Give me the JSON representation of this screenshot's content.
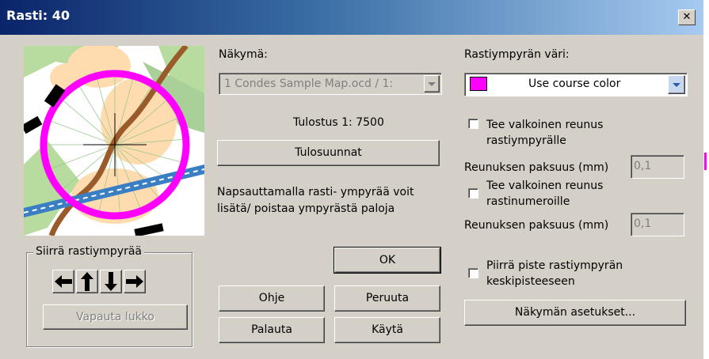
{
  "window": {
    "title": "Rasti: 40",
    "close_glyph": "✕"
  },
  "view": {
    "label": "Näkymä:",
    "select_value": "1 Condes Sample Map.ocd   / 1:",
    "print_scale": "Tulostus  1: 7500",
    "print_directions_button": "Tulosuunnat",
    "hint": "Napsauttamalla rasti- ympyrää voit\nlisätä/ poistaa ympyrästä paloja"
  },
  "move_group": {
    "legend": "Siirrä rastiympyrää",
    "arrows": [
      "arrow-left-icon",
      "arrow-up-icon",
      "arrow-down-icon",
      "arrow-right-icon"
    ],
    "unlock_button": "Vapauta lukko"
  },
  "buttons": {
    "ok": "OK",
    "help": "Ohje",
    "cancel": "Peruuta",
    "restore": "Palauta",
    "apply": "Käytä",
    "view_settings": "Näkymän asetukset..."
  },
  "circle_color": {
    "label": "Rastiympyrän väri:",
    "value": "Use course color",
    "swatch": "#ff00ff"
  },
  "white_border_circle": {
    "label": "Tee valkoinen reunus\nrastiympyrälle",
    "checked": false,
    "thickness_label": "Reunuksen paksuus (mm)",
    "thickness_value": "0,1"
  },
  "white_border_numbers": {
    "label": "Tee valkoinen reunus\nrastinumeroille",
    "checked": false,
    "thickness_label": "Reunuksen paksuus (mm)",
    "thickness_value": "0,1"
  },
  "center_dot": {
    "label": "Piirrä piste rastiympyrän\nkeskipisteeseen",
    "checked": false
  },
  "colors": {
    "title_start": "#0a246a",
    "title_end": "#a6caf0",
    "course": "#ff00ff",
    "face": "#d4d0c8"
  }
}
